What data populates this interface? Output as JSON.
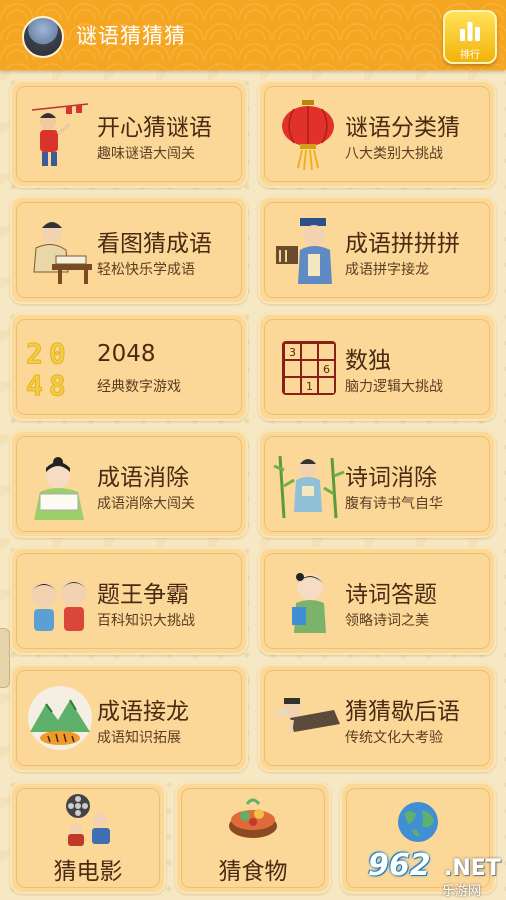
{
  "header": {
    "title": "谜语猜猜猜",
    "rank_label": "排行"
  },
  "games": [
    {
      "title": "开心猜谜语",
      "subtitle": "趣味谜语大闯关",
      "icon": "lantern-boy-icon"
    },
    {
      "title": "谜语分类猜",
      "subtitle": "八大类别大挑战",
      "icon": "red-lantern-icon"
    },
    {
      "title": "看图猜成语",
      "subtitle": "轻松快乐学成语",
      "icon": "scholar-reading-icon"
    },
    {
      "title": "成语拼拼拼",
      "subtitle": "成语拼字接龙",
      "icon": "ancient-teacher-icon"
    },
    {
      "title": "2048",
      "subtitle": "经典数字游戏",
      "icon": "2048-tiles-icon",
      "icon_text": "2048"
    },
    {
      "title": "数独",
      "subtitle": "脑力逻辑大挑战",
      "icon": "sudoku-grid-icon",
      "icon_digits": [
        "3",
        "6",
        "1"
      ]
    },
    {
      "title": "成语消除",
      "subtitle": "成语消除大闯关",
      "icon": "girl-with-scroll-icon"
    },
    {
      "title": "诗词消除",
      "subtitle": "腹有诗书气自华",
      "icon": "poet-bamboo-icon"
    },
    {
      "title": "题王争霸",
      "subtitle": "百科知识大挑战",
      "icon": "two-kids-icon"
    },
    {
      "title": "诗词答题",
      "subtitle": "领略诗词之美",
      "icon": "boy-reading-icon"
    },
    {
      "title": "成语接龙",
      "subtitle": "成语知识拓展",
      "icon": "mountain-tiger-icon"
    },
    {
      "title": "猜猜歇后语",
      "subtitle": "传统文化大考验",
      "icon": "reclining-sage-icon"
    }
  ],
  "bottom": [
    {
      "title": "猜电影",
      "icon": "film-reel-icon"
    },
    {
      "title": "猜食物",
      "icon": "food-bowl-icon"
    },
    {
      "title": "",
      "icon": "globe-icon"
    }
  ],
  "watermark": {
    "number": "962",
    "suffix": ".NET",
    "site": "乐游网"
  },
  "colors": {
    "topbar": "#f4a623",
    "card": "#fbd898",
    "title_text": "#4a2a12",
    "background": "#f7e8c4"
  }
}
